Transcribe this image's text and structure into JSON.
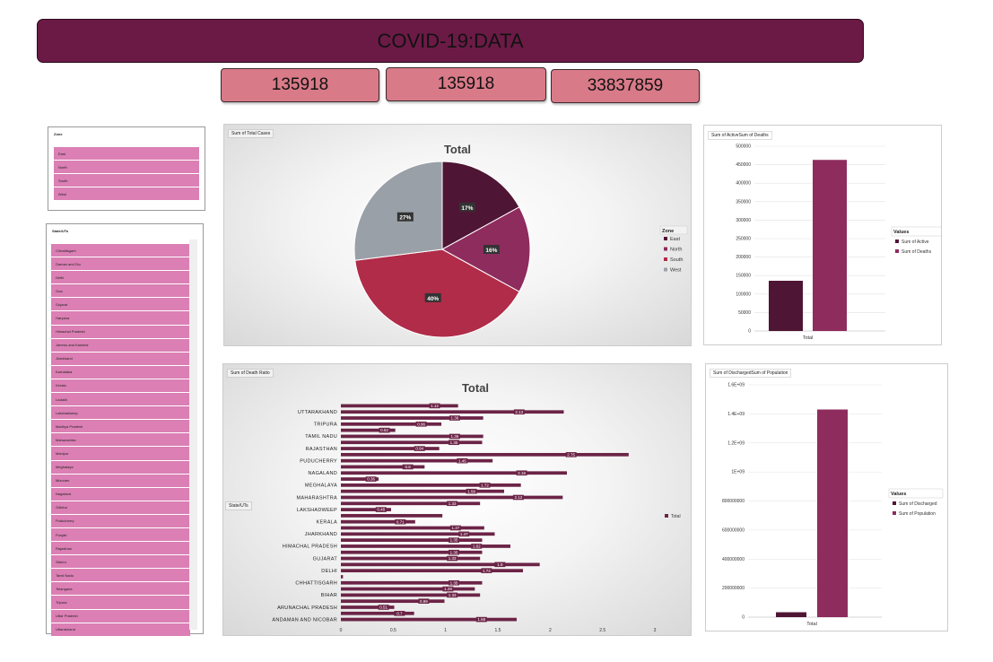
{
  "header": {
    "title": "COVID-19:DATA"
  },
  "kpis": [
    "135918",
    "135918",
    "33837859"
  ],
  "zone_slicer": {
    "title": "Zone",
    "items": [
      "East",
      "North",
      "South",
      "West"
    ]
  },
  "state_slicer": {
    "title": "State/UTs",
    "items": [
      "Chhattisgarh",
      "Daman and Diu",
      "Delhi",
      "Goa",
      "Gujarat",
      "Haryana",
      "Himachal Pradesh",
      "Jammu and Kashmir",
      "Jharkhand",
      "Karnataka",
      "Kerala",
      "Ladakh",
      "Lakshadweep",
      "Madhya Pradesh",
      "Maharashtra",
      "Manipur",
      "Meghalaya",
      "Mizoram",
      "Nagaland",
      "Odisha",
      "Puducherry",
      "Punjab",
      "Rajasthan",
      "Sikkim",
      "Tamil Nadu",
      "Telangana",
      "Tripura",
      "Uttar Pradesh",
      "Uttarakhand"
    ]
  },
  "colors": {
    "east": "#4f1534",
    "north": "#8e2c5e",
    "south": "#b02c48",
    "west": "#9aa0a8",
    "active": "#4f1534",
    "deaths": "#8e2c5e",
    "bar_ratio": "#6b2446"
  },
  "chart_data": [
    {
      "type": "pie",
      "field_tag": "Sum of Total Cases",
      "title": "Total",
      "legend_title": "Zone",
      "legend_position": "right",
      "slices": [
        {
          "name": "East",
          "value": 17,
          "label": "17%"
        },
        {
          "name": "North",
          "value": 16,
          "label": "16%"
        },
        {
          "name": "South",
          "value": 40,
          "label": "40%"
        },
        {
          "name": "West",
          "value": 27,
          "label": "27%"
        }
      ]
    },
    {
      "type": "bar",
      "field_tag": "Sum of ActiveSum of Deaths",
      "categories": [
        "Total"
      ],
      "series": [
        {
          "name": "Sum of Active",
          "values": [
            135918
          ]
        },
        {
          "name": "Sum of Deaths",
          "values": [
            463000
          ]
        }
      ],
      "legend_title": "Values",
      "legend_position": "right",
      "ylim": [
        0,
        500000
      ],
      "yticks": [
        "0",
        "50000",
        "100000",
        "150000",
        "200000",
        "250000",
        "300000",
        "350000",
        "400000",
        "450000",
        "500000"
      ]
    },
    {
      "type": "bar",
      "orientation": "horizontal",
      "field_tag": "Sum of Death Ratio",
      "title": "Total",
      "axis_field_tag": "State/UTs",
      "legend": "Total",
      "legend_position": "right",
      "xlim": [
        0,
        3
      ],
      "xticks": [
        "0",
        "0.5",
        "1",
        "1.5",
        "2",
        "2.5",
        "3"
      ],
      "categories": [
        "ANDAMAN AND NICOBAR",
        "",
        "ARUNACHAL PRADESH",
        "",
        "BIHAR",
        "",
        "CHHATTISGARH",
        "",
        "DELHI",
        "",
        "GUJARAT",
        "",
        "HIMACHAL PRADESH",
        "",
        "JHARKHAND",
        "",
        "KERALA",
        "",
        "LAKSHADWEEP",
        "",
        "MAHARASHTRA",
        "",
        "MEGHALAYA",
        "",
        "NAGALAND",
        "",
        "PUDUCHERRY",
        "",
        "RAJASTHAN",
        "",
        "TAMIL NADU",
        "",
        "TRIPURA",
        "",
        "UTTARAKHAND",
        ""
      ],
      "values": [
        1.68,
        0.7,
        0.51,
        0.99,
        1.33,
        1.28,
        1.35,
        0.02,
        1.74,
        1.9,
        1.33,
        1.35,
        1.62,
        1.35,
        1.47,
        1.37,
        0.71,
        0.97,
        0.48,
        1.33,
        2.12,
        1.56,
        1.72,
        0.36,
        2.16,
        0.8,
        1.45,
        2.75,
        0.94,
        1.35,
        1.36,
        0.52,
        0.96,
        1.36,
        2.13,
        1.12
      ],
      "data_labels": [
        "1.68",
        "0.7",
        "0.51",
        "0.99",
        "1.33",
        "1.28",
        "1.35",
        "",
        "1.74",
        "1.9",
        "1.33",
        "1.35",
        "1.62",
        "1.35",
        "1.47",
        "1.37",
        "0.71",
        "",
        "0.48",
        "1.33",
        "2.12",
        "1.56",
        "1.72",
        "0.36",
        "2.16",
        "0.8",
        "1.45",
        "2.75",
        "0.94",
        "1.35",
        "1.36",
        "0.52",
        "0.96",
        "1.36",
        "2.13",
        "1.12"
      ]
    },
    {
      "type": "bar",
      "field_tag": "Sum of DischargedSum of Population",
      "categories": [
        "Total"
      ],
      "series": [
        {
          "name": "Sum of Discharged",
          "values": [
            33837859
          ]
        },
        {
          "name": "Sum of Population",
          "values": [
            1430000000
          ]
        }
      ],
      "legend_title": "Values",
      "legend_position": "right",
      "ylim": [
        0,
        1600000000
      ],
      "yticks": [
        "0",
        "200000000",
        "400000000",
        "600000000",
        "800000000",
        "1E+09",
        "1.2E+09",
        "1.4E+09",
        "1.6E+09"
      ]
    }
  ]
}
